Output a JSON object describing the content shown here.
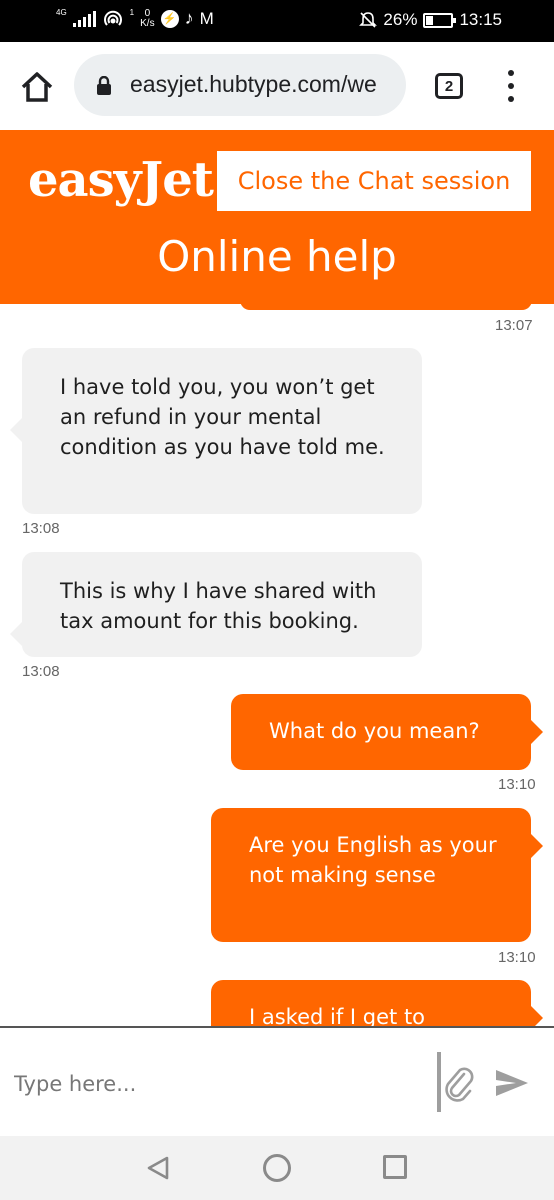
{
  "status_bar": {
    "network": "4G",
    "sim": "1",
    "speed_value": "0",
    "speed_unit": "K/s",
    "battery": "26%",
    "battery_level": 0.26,
    "time": "13:15"
  },
  "browser": {
    "url": "easyjet.hubtype.com/we",
    "tab_count": "2"
  },
  "header": {
    "logo": "easyJet",
    "close_button": "Close the Chat session",
    "title": "Online help"
  },
  "messages": [
    {
      "sender": "bot",
      "text": "",
      "time": "13:07"
    },
    {
      "sender": "bot",
      "text": "I have told you, you won’t get an refund in your mental condition as you have told me.",
      "time": "13:08"
    },
    {
      "sender": "bot",
      "text": "This is why I have shared with tax amount for this booking.",
      "time": "13:08"
    },
    {
      "sender": "user",
      "text": "What do you mean?",
      "time": "13:10"
    },
    {
      "sender": "user",
      "text": "Are you English as your not making sense",
      "time": "13:10"
    },
    {
      "sender": "user",
      "text": "I asked if I get to",
      "time": ""
    }
  ],
  "input": {
    "placeholder": "Type here..."
  },
  "colors": {
    "brand_orange": "#ff6600",
    "bot_bubble": "#f1f1f1",
    "status_bar": "#000000"
  },
  "icons": {
    "home": "home-icon",
    "lock": "lock-icon",
    "menu": "more-vert-icon",
    "attach": "paperclip-icon",
    "send": "send-icon",
    "nav_back": "triangle-back-icon",
    "nav_home": "circle-home-icon",
    "nav_recent": "square-recent-icon"
  }
}
